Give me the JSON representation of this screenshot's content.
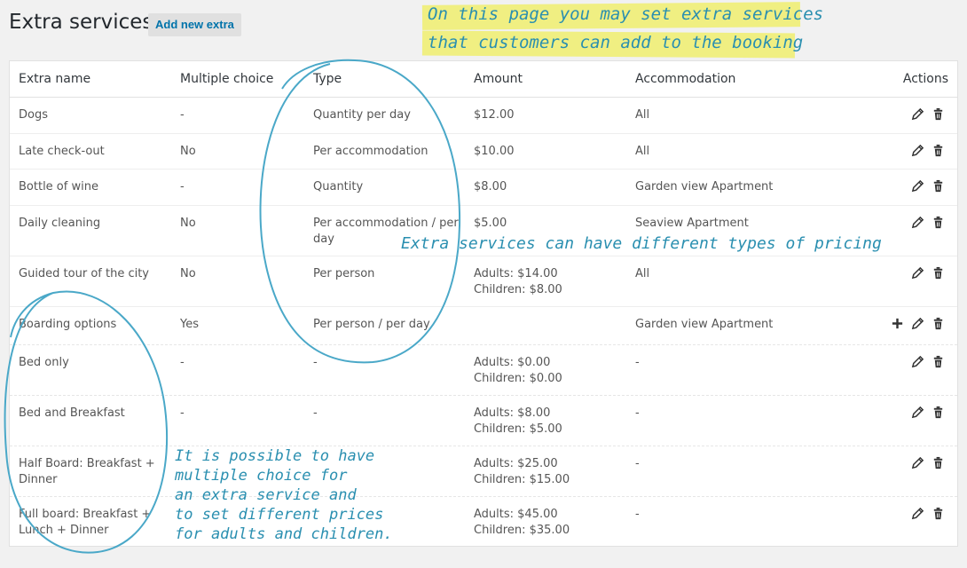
{
  "header": {
    "title": "Extra services",
    "add_button": "Add new extra"
  },
  "notes": {
    "top_line1": "On this page you may set extra services",
    "top_line2": "that customers can add to the booking",
    "pricing": "Extra services can have different types of pricing",
    "multi_line1": "It is possible to have",
    "multi_line2": "multiple choice for",
    "multi_line3": "an extra service and",
    "multi_line4": "to set different prices",
    "multi_line5": "for adults and children."
  },
  "table": {
    "columns": {
      "name": "Extra name",
      "multiple": "Multiple choice",
      "type": "Type",
      "amount": "Amount",
      "accommodation": "Accommodation",
      "actions": "Actions"
    },
    "rows": [
      {
        "name": "Dogs",
        "name2": "",
        "multiple": "-",
        "type": "Quantity per day",
        "type2": "",
        "amount": "$12.00",
        "amount2": "",
        "accommodation": "All"
      },
      {
        "name": "Late check-out",
        "name2": "",
        "multiple": "No",
        "type": "Per accommodation",
        "type2": "",
        "amount": "$10.00",
        "amount2": "",
        "accommodation": "All"
      },
      {
        "name": "Bottle of wine",
        "name2": "",
        "multiple": "-",
        "type": "Quantity",
        "type2": "",
        "amount": "$8.00",
        "amount2": "",
        "accommodation": "Garden view Apartment"
      },
      {
        "name": "Daily cleaning",
        "name2": "",
        "multiple": "No",
        "type": "Per accommodation / per",
        "type2": "day",
        "amount": "$5.00",
        "amount2": "",
        "accommodation": "Seaview Apartment"
      },
      {
        "name": "Guided tour of the city",
        "name2": "",
        "multiple": "No",
        "type": "Per person",
        "type2": "",
        "amount": "Adults: $14.00",
        "amount2": "Children: $8.00",
        "accommodation": "All"
      },
      {
        "name": "Boarding options",
        "name2": "",
        "multiple": "Yes",
        "type": "Per person / per day",
        "type2": "",
        "amount": "",
        "amount2": "",
        "accommodation": "Garden view Apartment"
      },
      {
        "name": "Bed only",
        "name2": "",
        "multiple": "-",
        "type": "-",
        "type2": "",
        "amount": "Adults: $0.00",
        "amount2": "Children: $0.00",
        "accommodation": "-"
      },
      {
        "name": "Bed and Breakfast",
        "name2": "",
        "multiple": "-",
        "type": "-",
        "type2": "",
        "amount": "Adults: $8.00",
        "amount2": "Children: $5.00",
        "accommodation": "-"
      },
      {
        "name": "Half Board: Breakfast +",
        "name2": "Dinner",
        "multiple": "",
        "type": "",
        "type2": "",
        "amount": "Adults: $25.00",
        "amount2": "Children: $15.00",
        "accommodation": "-"
      },
      {
        "name": "Full board: Breakfast +",
        "name2": "Lunch + Dinner",
        "multiple": "",
        "type": "",
        "type2": "",
        "amount": "Adults: $45.00",
        "amount2": "Children: $35.00",
        "accommodation": "-"
      }
    ]
  },
  "colors": {
    "annotation": "#2a8fb0",
    "highlight": "#f0ee6e",
    "link": "#0073aa"
  },
  "icons": [
    "pencil-icon",
    "trash-icon",
    "plus-icon"
  ]
}
